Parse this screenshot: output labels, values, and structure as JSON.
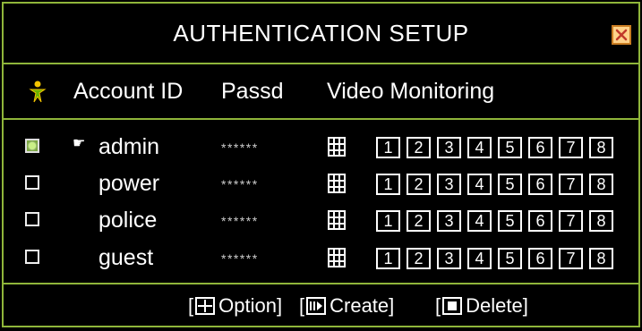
{
  "dialog": {
    "title": "AUTHENTICATION SETUP",
    "close_icon": "close-icon"
  },
  "header": {
    "account_id": "Account ID",
    "password": "Passd",
    "video_monitoring": "Video Monitoring"
  },
  "accounts": [
    {
      "name": "admin",
      "password": "******",
      "selected": true
    },
    {
      "name": "power",
      "password": "******",
      "selected": false
    },
    {
      "name": "police",
      "password": "******",
      "selected": false
    },
    {
      "name": "guest",
      "password": "******",
      "selected": false
    }
  ],
  "channels": [
    "1",
    "2",
    "3",
    "4",
    "5",
    "6",
    "7",
    "8"
  ],
  "footer": {
    "open_bracket": "[",
    "close_bracket": "]",
    "option": "Option",
    "create": "Create",
    "delete": "Delete"
  },
  "colors": {
    "border": "#8fb53a",
    "background": "#000000",
    "text": "#ffffff",
    "selected": "#7aa640"
  }
}
